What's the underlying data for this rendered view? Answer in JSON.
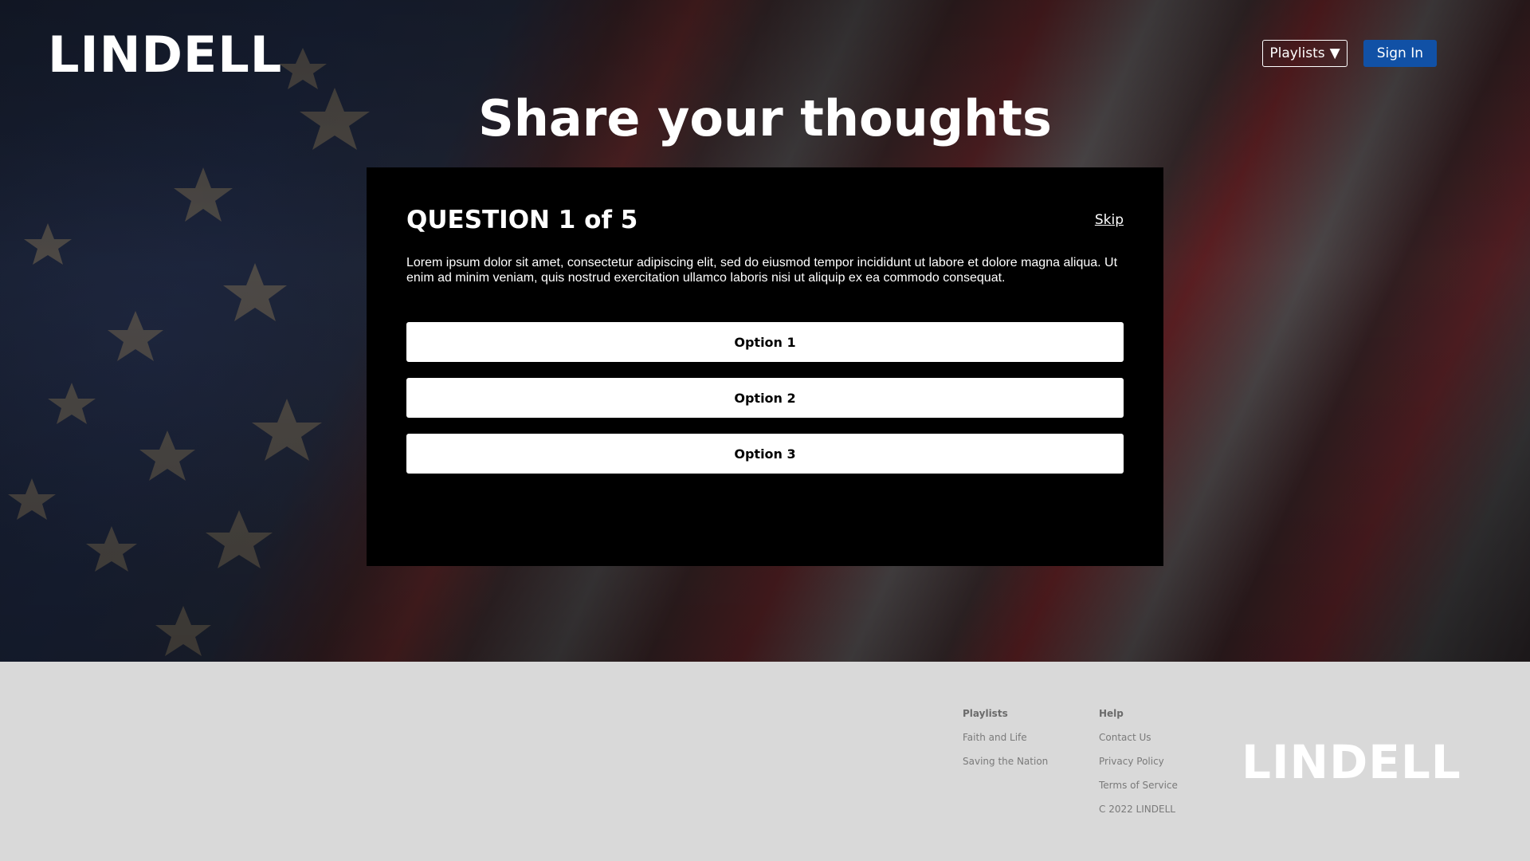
{
  "header": {
    "logo": "LINDELL",
    "playlists_label": "Playlists",
    "signin_label": "Sign In"
  },
  "hero": {
    "title": "Share your thoughts"
  },
  "question": {
    "label": "QUESTION 1 of 5",
    "skip_label": "Skip",
    "text": "Lorem ipsum dolor sit amet, consectetur adipiscing elit, sed do eiusmod tempor incididunt ut labore et dolore magna aliqua. Ut enim ad minim veniam, quis nostrud exercitation ullamco laboris nisi ut aliquip ex ea commodo consequat.",
    "options": [
      "Option 1",
      "Option 2",
      "Option 3"
    ]
  },
  "footer": {
    "playlists": {
      "heading": "Playlists",
      "links": [
        "Faith and Life",
        "Saving the Nation"
      ]
    },
    "help": {
      "heading": "Help",
      "links": [
        "Contact Us",
        "Privacy Policy",
        "Terms of Service"
      ],
      "copyright": "C 2022 LINDELL"
    },
    "logo": "LINDELL"
  },
  "colors": {
    "signin_bg": "#1151a6",
    "card_bg": "#000000",
    "footer_bg": "#d9d9d9"
  },
  "icons": {
    "playlists_dropdown": "caret-down-icon"
  }
}
